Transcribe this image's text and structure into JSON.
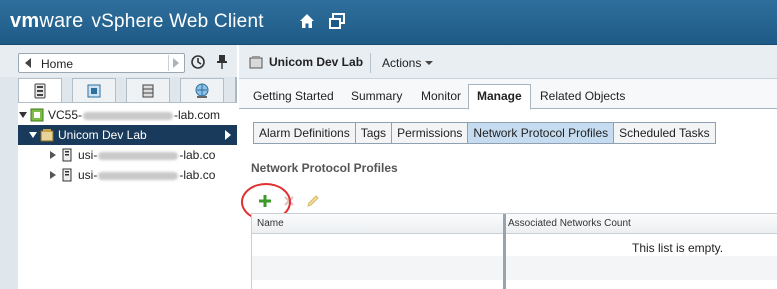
{
  "header": {
    "brand_vm": "vm",
    "brand_ware": "ware",
    "product": "vSphere Web Client"
  },
  "navigator": {
    "home_label": "Home",
    "tree": [
      {
        "prefix": "VC55-",
        "suffix": "-lab.com"
      },
      {
        "label": "Unicom Dev Lab"
      },
      {
        "prefix": "usi-",
        "suffix": "-lab.co"
      },
      {
        "prefix": "usi-",
        "suffix": "-lab.co"
      }
    ]
  },
  "object": {
    "title": "Unicom Dev Lab",
    "actions_label": "Actions"
  },
  "main_tabs": [
    "Getting Started",
    "Summary",
    "Monitor",
    "Manage",
    "Related Objects"
  ],
  "sub_tabs": [
    "Alarm Definitions",
    "Tags",
    "Permissions",
    "Network Protocol Profiles",
    "Scheduled Tasks"
  ],
  "content": {
    "section_title": "Network Protocol Profiles",
    "columns": [
      "Name",
      "Associated Networks Count"
    ],
    "empty_text": "This list is empty."
  },
  "colors": {
    "header_bg": "#1e5a86",
    "selected_tree_bg": "#1a3a5c",
    "active_subtab_bg": "#c5dcf0",
    "add_icon": "#3a9a2a",
    "highlight_circle": "#e03030"
  }
}
